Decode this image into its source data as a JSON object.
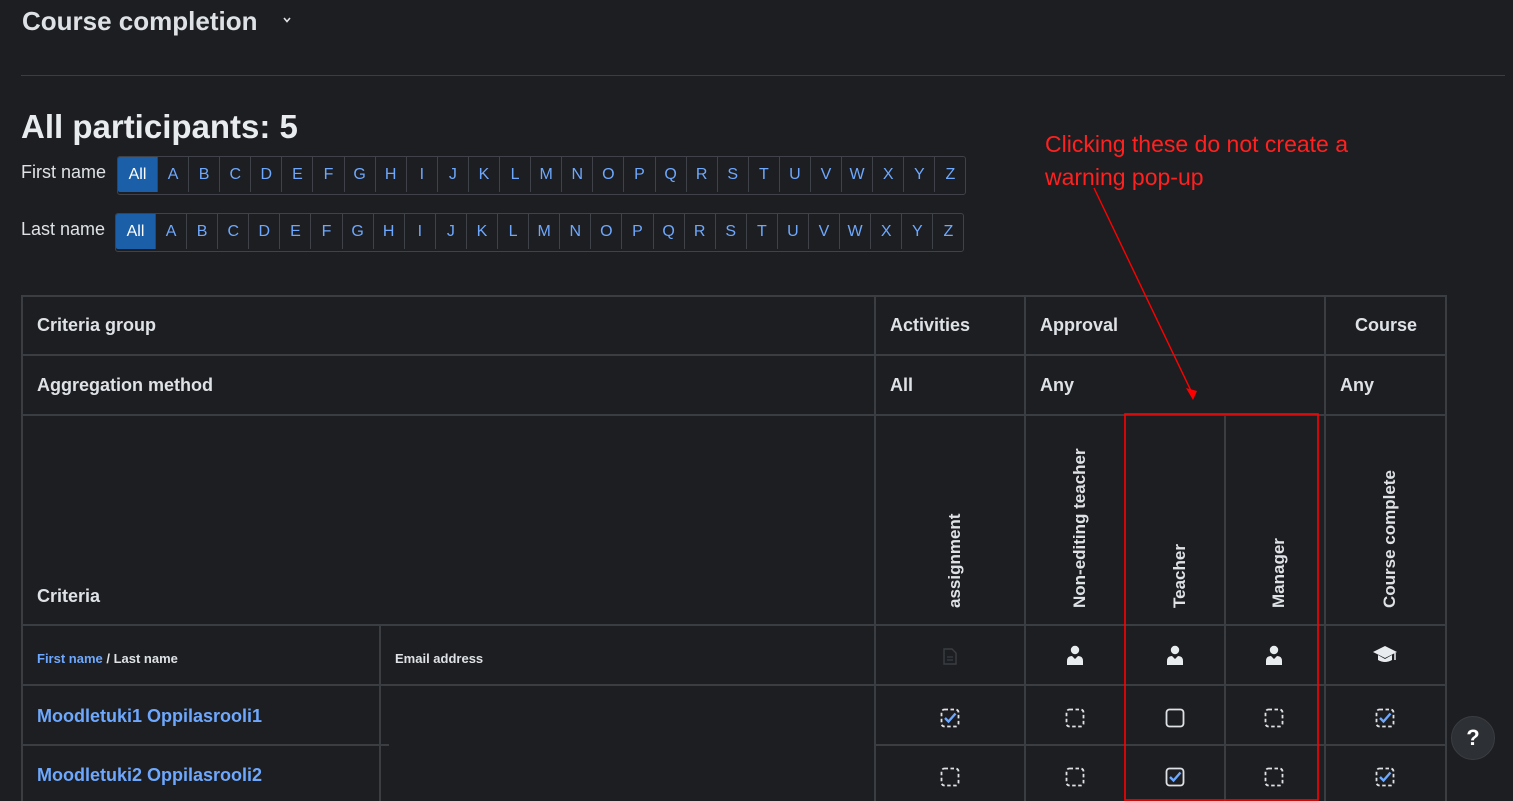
{
  "header": {
    "title": "Course completion"
  },
  "participants_heading": "All participants: 5",
  "filters": {
    "first_label": "First name",
    "last_label": "Last name",
    "letters": [
      "All",
      "A",
      "B",
      "C",
      "D",
      "E",
      "F",
      "G",
      "H",
      "I",
      "J",
      "K",
      "L",
      "M",
      "N",
      "O",
      "P",
      "Q",
      "R",
      "S",
      "T",
      "U",
      "V",
      "W",
      "X",
      "Y",
      "Z"
    ]
  },
  "table": {
    "criteria_group_label": "Criteria group",
    "aggregation_label": "Aggregation method",
    "criteria_label": "Criteria",
    "groups": {
      "activities": "Activities",
      "approval": "Approval",
      "course": "Course"
    },
    "aggregation": {
      "activities": "All",
      "approval": "Any",
      "course": "Any"
    },
    "criteria": [
      "assignment",
      "Non-editing teacher",
      "Teacher",
      "Manager",
      "Course complete"
    ],
    "name_header": {
      "first": "First name",
      "sep": " / ",
      "last": "Last name"
    },
    "email_header": "Email address",
    "rows": [
      {
        "name": "Moodletuki1 Oppilasrooli1",
        "email": "",
        "status": [
          "complete-auto",
          "not-complete-dashed",
          "not-complete",
          "not-complete-dashed",
          "complete-auto"
        ]
      },
      {
        "name": "Moodletuki2 Oppilasrooli2",
        "email": "",
        "status": [
          "not-complete-dashed",
          "not-complete-dashed",
          "complete",
          "not-complete-dashed",
          "complete-auto"
        ]
      }
    ],
    "header_icons": [
      "assignment-icon",
      "user-icon",
      "user-icon",
      "user-icon",
      "graduation-cap-icon"
    ]
  },
  "annotation": {
    "line1": "Clicking these do not create a",
    "line2": "warning pop-up",
    "color": "#ff0000"
  },
  "help": {
    "label": "?"
  },
  "colors": {
    "background": "#1d1e21",
    "link": "#6ea8fe",
    "active_letter": "#1a5fa8",
    "check": "#6ea8fe"
  }
}
